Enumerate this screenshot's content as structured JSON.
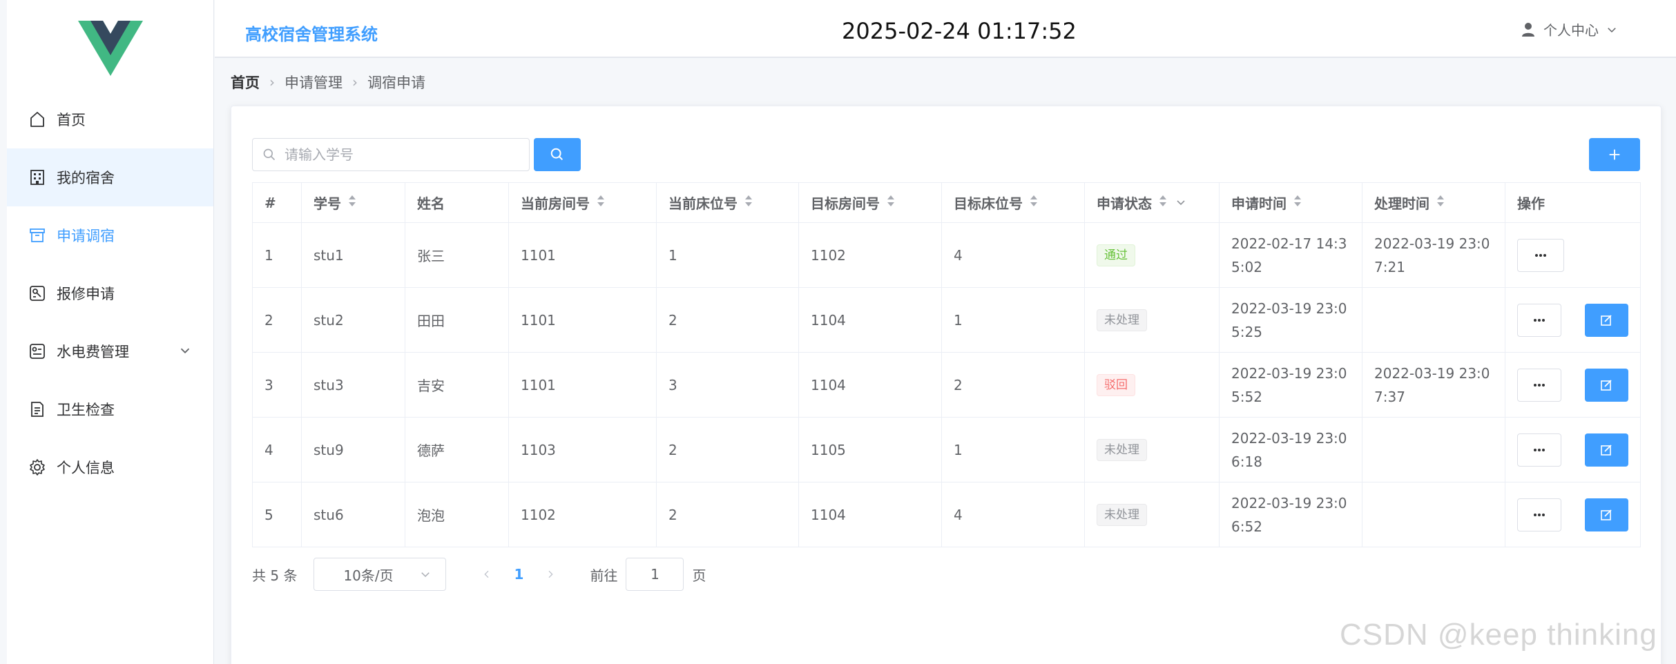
{
  "header": {
    "system_title": "高校宿舍管理系统",
    "datetime": "2025-02-24 01:17:52",
    "user_menu_label": "个人中心"
  },
  "sidebar": {
    "items": [
      {
        "label": "首页",
        "icon": "home-icon"
      },
      {
        "label": "我的宿舍",
        "icon": "building-icon"
      },
      {
        "label": "申请调宿",
        "icon": "box-icon"
      },
      {
        "label": "报修申请",
        "icon": "wrench-doc-icon"
      },
      {
        "label": "水电费管理",
        "icon": "utility-icon"
      },
      {
        "label": "卫生检查",
        "icon": "document-icon"
      },
      {
        "label": "个人信息",
        "icon": "gear-icon"
      }
    ],
    "active_item": "申请调宿",
    "hover_item": "我的宿舍"
  },
  "breadcrumb": [
    "首页",
    "申请管理",
    "调宿申请"
  ],
  "search": {
    "placeholder": "请输入学号",
    "value": ""
  },
  "table": {
    "columns": [
      "#",
      "学号",
      "姓名",
      "当前房间号",
      "当前床位号",
      "目标房间号",
      "目标床位号",
      "申请状态",
      "申请时间",
      "处理时间",
      "操作"
    ],
    "rows": [
      {
        "idx": "1",
        "sid": "stu1",
        "name": "张三",
        "cur_room": "1101",
        "cur_bed": "1",
        "tgt_room": "1102",
        "tgt_bed": "4",
        "status": "通过",
        "status_type": "success",
        "apply_time": "2022-02-17 14:35:02",
        "handle_time": "2022-03-19 23:07:21",
        "editable": false
      },
      {
        "idx": "2",
        "sid": "stu2",
        "name": "田田",
        "cur_room": "1101",
        "cur_bed": "2",
        "tgt_room": "1104",
        "tgt_bed": "1",
        "status": "未处理",
        "status_type": "info",
        "apply_time": "2022-03-19 23:05:25",
        "handle_time": "",
        "editable": true
      },
      {
        "idx": "3",
        "sid": "stu3",
        "name": "吉安",
        "cur_room": "1101",
        "cur_bed": "3",
        "tgt_room": "1104",
        "tgt_bed": "2",
        "status": "驳回",
        "status_type": "danger",
        "apply_time": "2022-03-19 23:05:52",
        "handle_time": "2022-03-19 23:07:37",
        "editable": true
      },
      {
        "idx": "4",
        "sid": "stu9",
        "name": "德萨",
        "cur_room": "1103",
        "cur_bed": "2",
        "tgt_room": "1105",
        "tgt_bed": "1",
        "status": "未处理",
        "status_type": "info",
        "apply_time": "2022-03-19 23:06:18",
        "handle_time": "",
        "editable": true
      },
      {
        "idx": "5",
        "sid": "stu6",
        "name": "泡泡",
        "cur_room": "1102",
        "cur_bed": "2",
        "tgt_room": "1104",
        "tgt_bed": "4",
        "status": "未处理",
        "status_type": "info",
        "apply_time": "2022-03-19 23:06:52",
        "handle_time": "",
        "editable": true
      }
    ]
  },
  "pagination": {
    "total_text": "共 5 条",
    "page_size": "10条/页",
    "current_page": "1",
    "goto_label": "前往",
    "goto_value": "1",
    "page_suffix": "页"
  },
  "watermark": "CSDN @keep   thinking",
  "colors": {
    "primary": "#409eff",
    "success": "#67c23a",
    "danger": "#f56c6c",
    "info": "#909399"
  }
}
